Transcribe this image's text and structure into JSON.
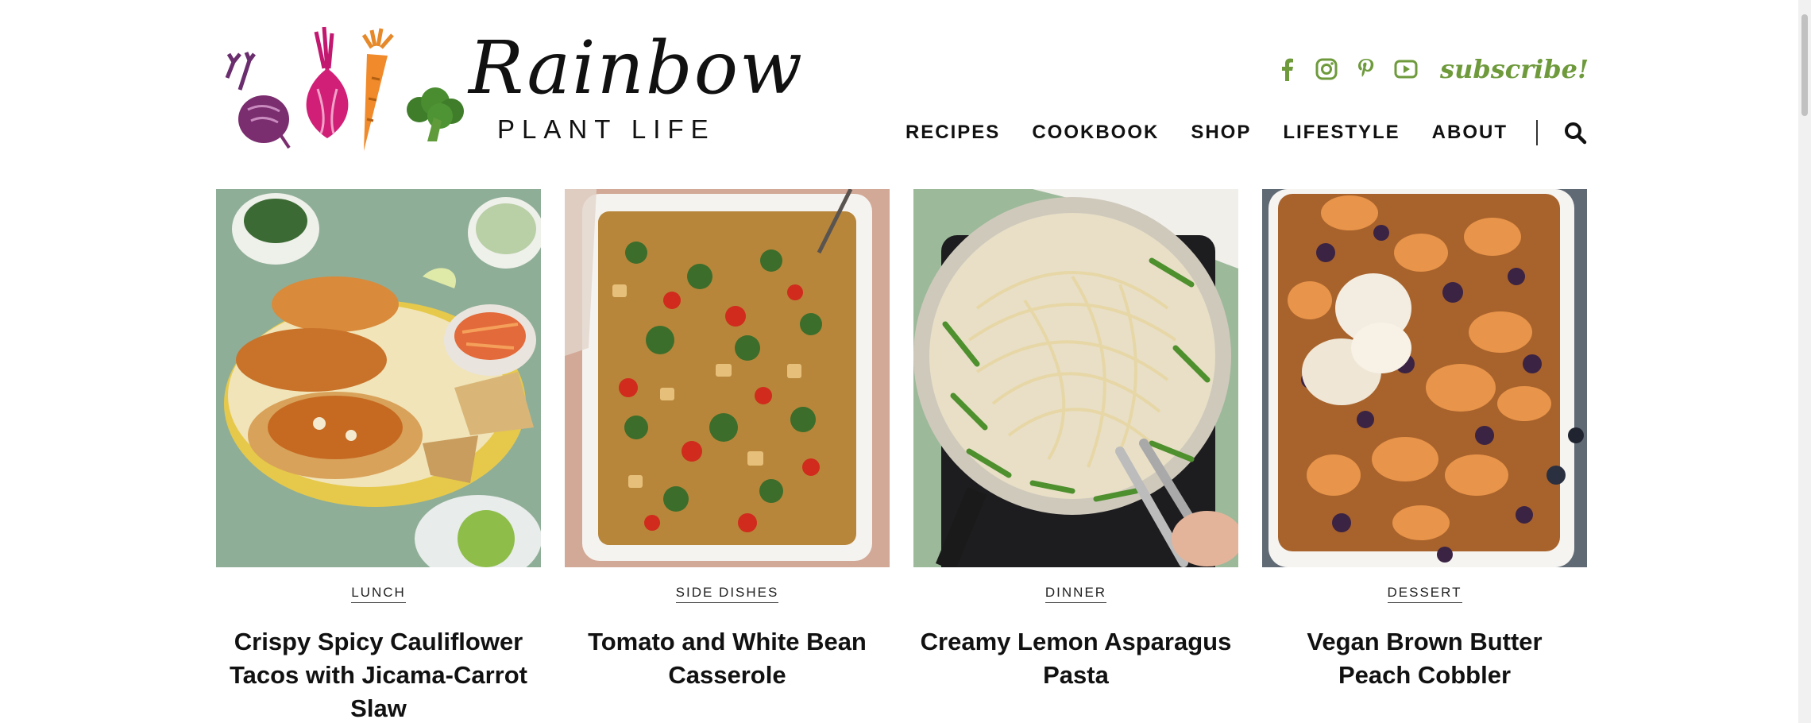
{
  "brand": {
    "script": "Rainbow",
    "sub": "PLANT LIFE"
  },
  "social": {
    "icons": [
      "facebook-icon",
      "instagram-icon",
      "pinterest-icon",
      "youtube-icon"
    ],
    "subscribe": "subscribe!",
    "accent_color": "#6e9a3c"
  },
  "nav": {
    "items": [
      "RECIPES",
      "COOKBOOK",
      "SHOP",
      "LIFESTYLE",
      "ABOUT"
    ],
    "search_icon": "search-icon"
  },
  "cards": [
    {
      "category": "LUNCH",
      "title": "Crispy Spicy Cauliflower Tacos with Jicama-Carrot Slaw"
    },
    {
      "category": "SIDE DISHES",
      "title": "Tomato and White Bean Casserole"
    },
    {
      "category": "DINNER",
      "title": "Creamy Lemon Asparagus Pasta"
    },
    {
      "category": "DESSERT",
      "title": "Vegan Brown Butter Peach Cobbler"
    }
  ]
}
